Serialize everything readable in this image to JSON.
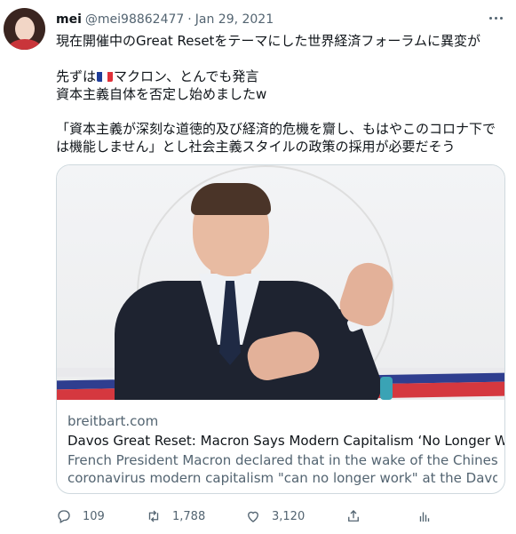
{
  "user": {
    "name": "mei",
    "handle": "@mei98862477",
    "separator": "·",
    "date": "Jan 29, 2021"
  },
  "tweet": {
    "line1": "現在開催中のGreat Resetをテーマにした世界経済フォーラムに異変が",
    "line2_prefix": "先ずは",
    "line2_suffix": "マクロン、とんでも発言",
    "line3": "資本主義自体を否定し始めましたw",
    "line4": "「資本主義が深刻な道徳的及び経済的危機を齎し、もはやこのコロナ下で",
    "line5": "は機能しません」とし社会主義スタイルの政策の採用が必要だそう"
  },
  "flag": {
    "icon": "france-flag-icon",
    "colors": [
      "#1f3d99",
      "#ffffff",
      "#e0323a"
    ]
  },
  "card": {
    "domain": "breitbart.com",
    "title": "Davos Great Reset: Macron Says Modern Capitalism ‘No Longer Works’",
    "description_line1": "French President Macron declared that in the wake of the Chinese",
    "description_line2": "coronavirus modern capitalism \"can no longer work\" at the Davos ..."
  },
  "actions": {
    "reply": {
      "icon": "reply-icon",
      "count": "109"
    },
    "retweet": {
      "icon": "retweet-icon",
      "count": "1,788"
    },
    "like": {
      "icon": "like-icon",
      "count": "3,120"
    },
    "share": {
      "icon": "share-icon"
    },
    "analytics": {
      "icon": "analytics-icon"
    }
  }
}
